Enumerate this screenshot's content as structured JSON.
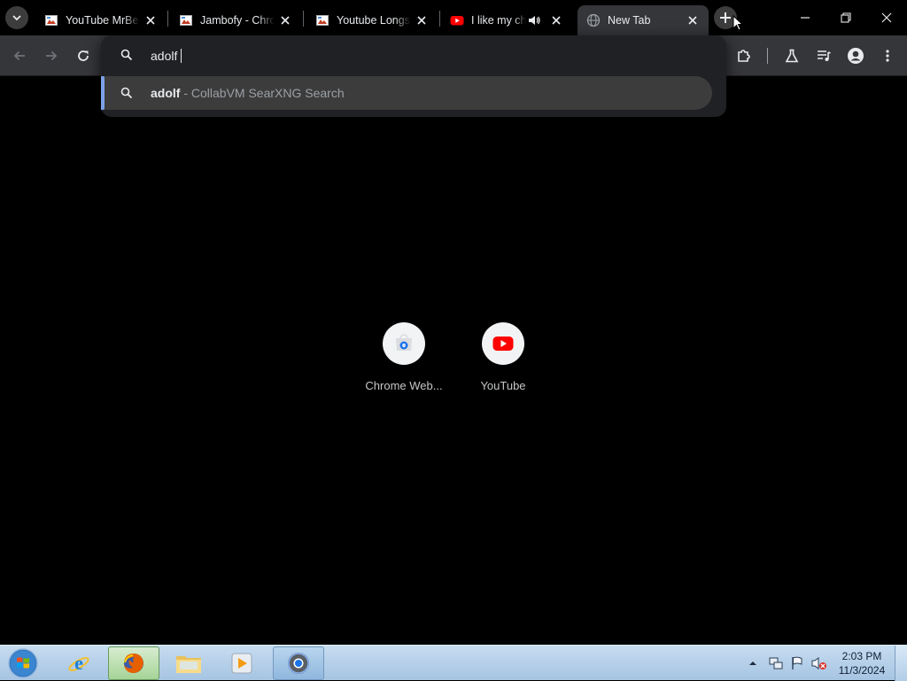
{
  "tabs": [
    {
      "title": "YouTube MrBeast",
      "favicon": "broken-image-icon"
    },
    {
      "title": "Jambofy - Chrome",
      "favicon": "broken-image-icon"
    },
    {
      "title": "Youtube Longs",
      "favicon": "broken-image-icon"
    },
    {
      "title": "I like my cheese",
      "favicon": "youtube-icon",
      "audio": true
    },
    {
      "title": "New Tab",
      "favicon": "globe-icon",
      "active": true
    }
  ],
  "omnibox": {
    "input_value": "adolf",
    "suggestion": {
      "query": "adolf",
      "description": " - CollabVM SearXNG Search"
    }
  },
  "shortcuts": [
    {
      "label": "Chrome Web...",
      "icon": "chrome-web-store-icon"
    },
    {
      "label": "YouTube",
      "icon": "youtube-icon"
    }
  ],
  "taskbar": {
    "clock_time": "2:03 PM",
    "clock_date": "11/3/2024",
    "apps": [
      "internet-explorer-icon",
      "firefox-icon",
      "file-explorer-icon",
      "media-player-icon",
      "chrome-icon"
    ]
  },
  "colors": {
    "accent": "#7ca1e8",
    "youtube_red": "#ff0000",
    "tab_active": "#35363a"
  }
}
